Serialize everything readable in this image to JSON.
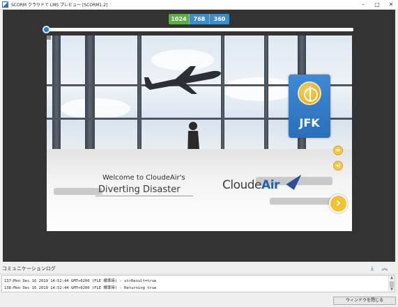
{
  "window": {
    "title": "SCORM クラウドで LMS プレビュー [SCORM1.2]",
    "minimize": "–",
    "maximize": "□",
    "close": "✕"
  },
  "size_selector": {
    "options": [
      "1024",
      "768",
      "360"
    ],
    "selected": "1024"
  },
  "slide": {
    "welcome": "Welcome to CloudeAir's",
    "course_title": "Diverting Disaster",
    "logo_part1": "Cloude",
    "logo_part2": "Air",
    "destination": "JFK",
    "menu_glyph": "≡",
    "audio_glyph": "◂)",
    "next_glyph": "›"
  },
  "log": {
    "title": "コミュニケーションログ",
    "download_icon": "⤓",
    "collapse_icon": "︽",
    "lines": [
      "137:Mon Dec 16 2019 14:52:44 GMT+0200 (FLE 標準時) - strResult=true",
      "138:Mon Dec 16 2019 14:52:44 GMT+0200 (FLE 標準時) - Returning true"
    ],
    "scroll_up": "▲",
    "scroll_down": "▼"
  },
  "footer": {
    "close_window_label": "ウィンドウを閉じる"
  },
  "colors": {
    "preview_bg": "#333333",
    "size_active": "#5fae45",
    "size_inactive": "#3d8ec6",
    "card_blue": "#2a6fba",
    "accent_yellow": "#f2c230"
  }
}
